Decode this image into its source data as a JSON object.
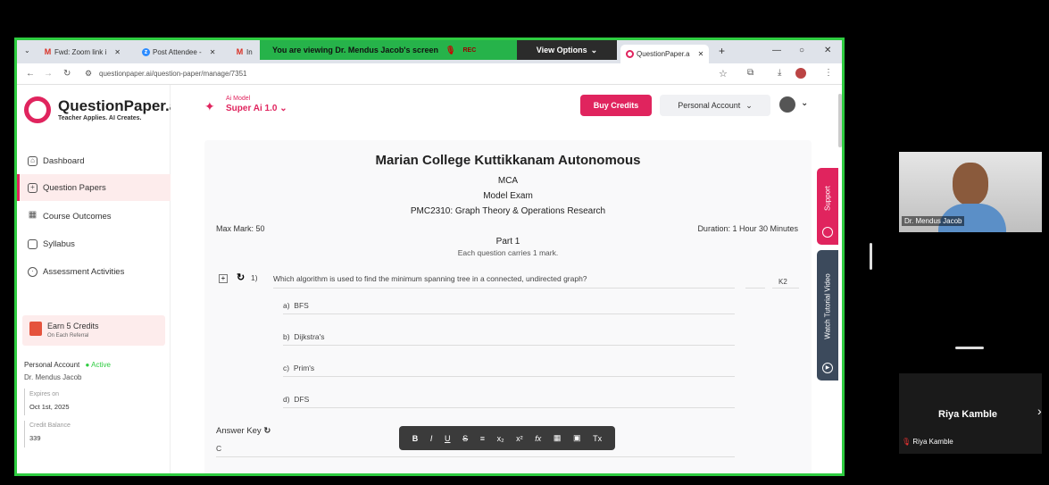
{
  "browser": {
    "tabs": [
      {
        "label": "Fwd: Zoom link i",
        "icon": "gmail-icon"
      },
      {
        "label": "Post Attendee -",
        "icon": "zoom-icon"
      },
      {
        "label": "In",
        "icon": "gmail-icon"
      },
      {
        "label": "QuestionPaper.a",
        "icon": "questionpaper-icon"
      }
    ],
    "new_tab": "+",
    "url": "questionpaper.ai/question-paper/manage/7351"
  },
  "zoom": {
    "viewing_banner": "You are viewing  Dr. Mendus Jacob's screen",
    "rec_label": "REC",
    "view_options": "View Options"
  },
  "app": {
    "logo_name": "QuestionPaper.ai",
    "logo_tagline": "Teacher Applies. AI Creates.",
    "ai_model_label": "Ai Model",
    "ai_model_value": "Super Ai 1.0",
    "buy_credits": "Buy Credits",
    "account_menu": "Personal Account",
    "nav": [
      {
        "label": "Dashboard",
        "icon": "home-icon"
      },
      {
        "label": "Question Papers",
        "icon": "document-plus-icon"
      },
      {
        "label": "Course Outcomes",
        "icon": "grid-icon"
      },
      {
        "label": "Syllabus",
        "icon": "file-icon"
      },
      {
        "label": "Assessment Activities",
        "icon": "clock-icon"
      }
    ],
    "referral": {
      "title": "Earn 5 Credits",
      "subtitle": "On Each Referral"
    },
    "account": {
      "type": "Personal Account",
      "status": "Active",
      "name": "Dr. Mendus Jacob",
      "expires_label": "Expires on",
      "expires_value": "Oct 1st, 2025",
      "credit_label": "Credit Balance",
      "credit_value": "339"
    },
    "support_tab": "Support",
    "tutorial_tab": "Watch Tutorial Video"
  },
  "paper": {
    "college": "Marian College Kuttikkanam Autonomous",
    "program": "MCA",
    "exam": "Model Exam",
    "course": "PMC2310: Graph Theory & Operations Research",
    "max_mark": "Max Mark: 50",
    "duration": "Duration: 1 Hour 30 Minutes",
    "part": "Part 1",
    "part_note": "Each question carries 1 mark.",
    "question_number": "1)",
    "question_text": "Which algorithm is used to find the minimum spanning tree in a connected, undirected graph?",
    "level": "K2",
    "options": [
      {
        "key": "a)",
        "text": "BFS"
      },
      {
        "key": "b)",
        "text": "Dijkstra's"
      },
      {
        "key": "c)",
        "text": "Prim's"
      },
      {
        "key": "d)",
        "text": "DFS"
      }
    ],
    "answer_key_label": "Answer Key",
    "answer_value": "C",
    "toolbar": [
      "B",
      "I",
      "U",
      "S",
      "≡",
      "x₂",
      "x²",
      "fx",
      "▦",
      "▣",
      "Tx"
    ]
  },
  "participants": [
    {
      "name": "Dr. Mendus Jacob"
    },
    {
      "name": "Riya Kamble",
      "muted": true
    }
  ],
  "colors": {
    "accent": "#e0245e",
    "share_border": "#2ecc40",
    "active": "#2ecc40"
  }
}
